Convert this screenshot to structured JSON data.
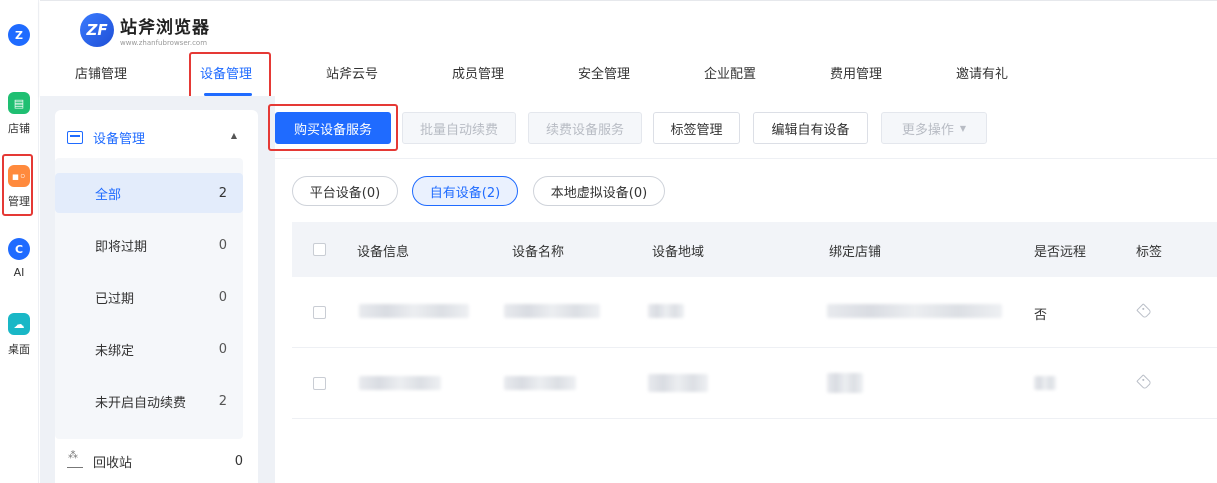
{
  "rail": {
    "items": [
      {
        "label": "",
        "icon": "browser-logo-icon",
        "color": "#1f6bff"
      },
      {
        "label": "店铺",
        "icon": "store-icon",
        "color": "#1fbf72"
      },
      {
        "label": "管理",
        "icon": "manage-icon",
        "color": "#ff8a3d"
      },
      {
        "label": "AI",
        "icon": "ai-icon",
        "color": "#1f6bff"
      },
      {
        "label": "桌面",
        "icon": "cloud-desktop-icon",
        "color": "#19b7c6"
      }
    ]
  },
  "header": {
    "logo_title": "站斧浏览器",
    "logo_sub": "www.zhanfubrowser.com",
    "logo_mark": "ZF",
    "nav": [
      "店铺管理",
      "设备管理",
      "站斧云号",
      "成员管理",
      "安全管理",
      "企业配置",
      "费用管理",
      "邀请有礼"
    ],
    "active_nav": "设备管理"
  },
  "sidebar": {
    "title": "设备管理",
    "items": [
      {
        "label": "全部",
        "count": "2",
        "active": true
      },
      {
        "label": "即将过期",
        "count": "0"
      },
      {
        "label": "已过期",
        "count": "0"
      },
      {
        "label": "未绑定",
        "count": "0"
      },
      {
        "label": "未开启自动续费",
        "count": "2"
      }
    ],
    "recycle": {
      "label": "回收站",
      "count": "0"
    }
  },
  "toolbar": {
    "buy": "购买设备服务",
    "batch_renew": "批量自动续费",
    "renew": "续费设备服务",
    "tags": "标签管理",
    "edit_own": "编辑自有设备",
    "more": "更多操作"
  },
  "filters": [
    "平台设备(0)",
    "自有设备(2)",
    "本地虚拟设备(0)"
  ],
  "table": {
    "headers": [
      "设备信息",
      "设备名称",
      "设备地域",
      "绑定店铺",
      "是否远程",
      "标签"
    ],
    "rows": [
      {
        "remote": "否"
      },
      {
        "remote": ""
      }
    ]
  },
  "colors": {
    "accent": "#1f6bff",
    "highlight": "#e53935"
  }
}
